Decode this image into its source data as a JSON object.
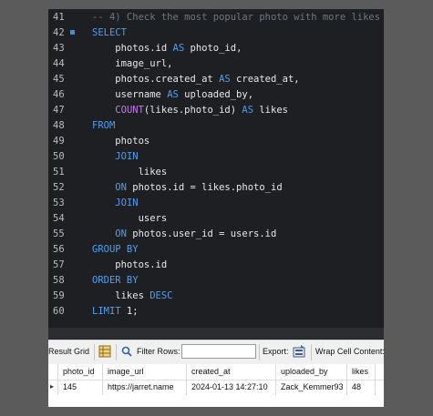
{
  "editor": {
    "lines": [
      {
        "n": "41",
        "parts": [
          [
            "cmt",
            "-- 4) Check the most popular photo with more likes"
          ]
        ]
      },
      {
        "n": "42",
        "marker": true,
        "parts": [
          [
            "kw",
            "SELECT"
          ]
        ]
      },
      {
        "n": "43",
        "parts": [
          [
            "txt",
            "    photos.id "
          ],
          [
            "kw",
            "AS"
          ],
          [
            "txt",
            " photo_id,"
          ]
        ]
      },
      {
        "n": "44",
        "parts": [
          [
            "txt",
            "    image_url,"
          ]
        ]
      },
      {
        "n": "45",
        "parts": [
          [
            "txt",
            "    photos.created_at "
          ],
          [
            "kw",
            "AS"
          ],
          [
            "txt",
            " created_at,"
          ]
        ]
      },
      {
        "n": "46",
        "parts": [
          [
            "txt",
            "    username "
          ],
          [
            "kw",
            "AS"
          ],
          [
            "txt",
            " uploaded_by,"
          ]
        ]
      },
      {
        "n": "47",
        "parts": [
          [
            "txt",
            "    "
          ],
          [
            "fn",
            "COUNT"
          ],
          [
            "txt",
            "(likes.photo_id) "
          ],
          [
            "kw",
            "AS"
          ],
          [
            "txt",
            " likes"
          ]
        ]
      },
      {
        "n": "48",
        "parts": [
          [
            "kw",
            "FROM"
          ]
        ]
      },
      {
        "n": "49",
        "parts": [
          [
            "txt",
            "    photos"
          ]
        ]
      },
      {
        "n": "50",
        "parts": [
          [
            "txt",
            "    "
          ],
          [
            "kw",
            "JOIN"
          ]
        ]
      },
      {
        "n": "51",
        "parts": [
          [
            "txt",
            "        likes"
          ]
        ]
      },
      {
        "n": "52",
        "parts": [
          [
            "txt",
            "    "
          ],
          [
            "kw",
            "ON"
          ],
          [
            "txt",
            " photos.id = likes.photo_id"
          ]
        ]
      },
      {
        "n": "53",
        "parts": [
          [
            "txt",
            "    "
          ],
          [
            "kw",
            "JOIN"
          ]
        ]
      },
      {
        "n": "54",
        "parts": [
          [
            "txt",
            "        users"
          ]
        ]
      },
      {
        "n": "55",
        "parts": [
          [
            "txt",
            "    "
          ],
          [
            "kw",
            "ON"
          ],
          [
            "txt",
            " photos.user_id = users.id"
          ]
        ]
      },
      {
        "n": "56",
        "parts": [
          [
            "kw",
            "GROUP BY"
          ]
        ]
      },
      {
        "n": "57",
        "parts": [
          [
            "txt",
            "    photos.id"
          ]
        ]
      },
      {
        "n": "58",
        "parts": [
          [
            "kw",
            "ORDER BY"
          ]
        ]
      },
      {
        "n": "59",
        "parts": [
          [
            "txt",
            "    likes "
          ],
          [
            "kw",
            "DESC"
          ]
        ]
      },
      {
        "n": "60",
        "parts": [
          [
            "kw",
            "LIMIT"
          ],
          [
            "txt",
            " 1;"
          ]
        ]
      }
    ]
  },
  "toolbar": {
    "result_grid_label": "Result Grid",
    "filter_rows_label": "Filter Rows:",
    "filter_rows_value": "",
    "export_label": "Export:",
    "wrap_label": "Wrap Cell Content:"
  },
  "grid": {
    "columns": [
      "photo_id",
      "image_url",
      "created_at",
      "uploaded_by",
      "likes"
    ],
    "rows": [
      [
        "145",
        "https://jarret.name",
        "2024-01-13 14:27:10",
        "Zack_Kemmer93",
        "48"
      ]
    ]
  },
  "colors": {
    "keyword": "#4f9ef0",
    "function": "#c27ae6",
    "comment": "#6e7681",
    "editor_bg": "#1e1f22"
  }
}
